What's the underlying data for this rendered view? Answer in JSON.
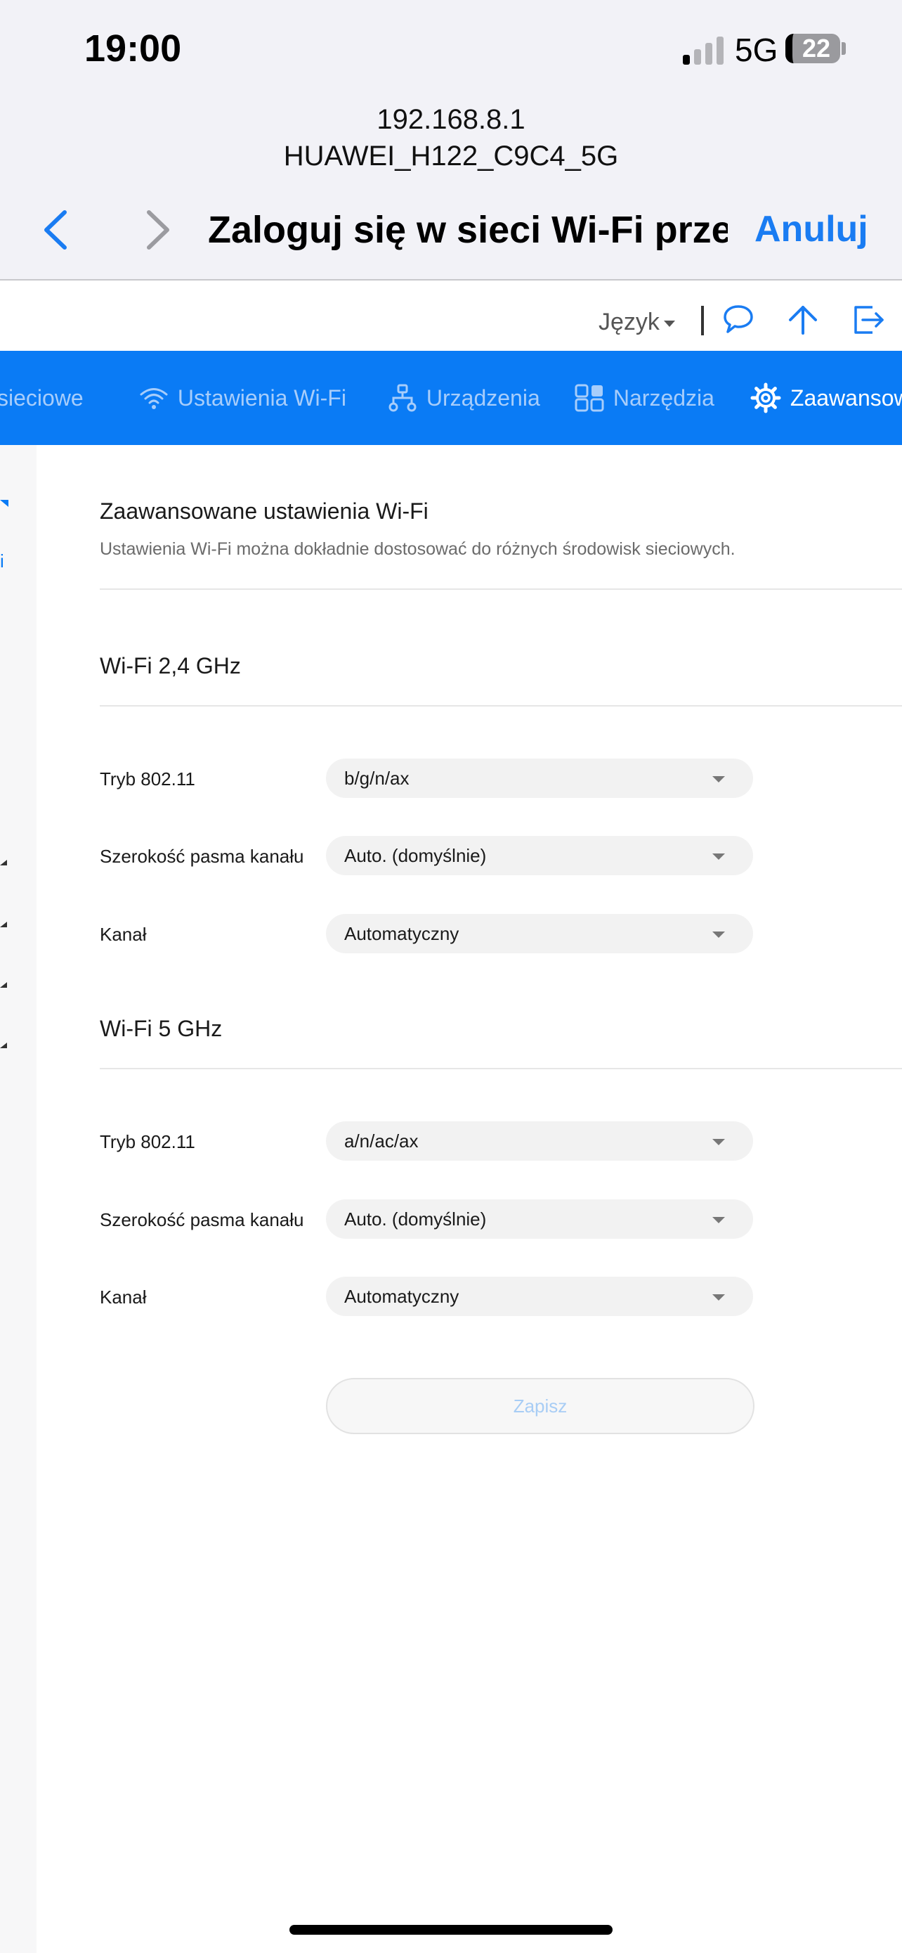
{
  "status_bar": {
    "time": "19:00",
    "network": "5G",
    "battery": "22"
  },
  "portal": {
    "url": "192.168.8.1",
    "ssid": "HUAWEI_H122_C9C4_5G",
    "title": "Zaloguj się w sieci Wi-Fi prze...",
    "cancel_label": "Anuluj"
  },
  "top_bar": {
    "language_label": "Język"
  },
  "nav": {
    "items": [
      {
        "label": "sieciowe",
        "icon": "none"
      },
      {
        "label": "Ustawienia Wi-Fi",
        "icon": "wifi-icon"
      },
      {
        "label": "Urządzenia",
        "icon": "devices-icon"
      },
      {
        "label": "Narzędzia",
        "icon": "tools-icon"
      },
      {
        "label": "Zaawansowane",
        "icon": "gear-icon",
        "active": true
      }
    ]
  },
  "sidebar": {
    "fragment_text": "i"
  },
  "page": {
    "title": "Zaawansowane ustawienia Wi-Fi",
    "description": "Ustawienia Wi-Fi można dokładnie dostosować do różnych środowisk sieciowych."
  },
  "wifi24": {
    "title": "Wi-Fi 2,4 GHz",
    "fields": [
      {
        "label": "Tryb 802.11",
        "value": "b/g/n/ax"
      },
      {
        "label": "Szerokość pasma kanału",
        "value": "Auto. (domyślnie)"
      },
      {
        "label": "Kanał",
        "value": "Automatyczny"
      }
    ]
  },
  "wifi5": {
    "title": "Wi-Fi 5 GHz",
    "fields": [
      {
        "label": "Tryb 802.11",
        "value": "a/n/ac/ax"
      },
      {
        "label": "Szerokość pasma kanału",
        "value": "Auto. (domyślnie)"
      },
      {
        "label": "Kanał",
        "value": "Automatyczny"
      }
    ]
  },
  "actions": {
    "save_label": "Zapisz"
  },
  "colors": {
    "accent": "#0a7bf5",
    "ios_blue": "#1a7cf2",
    "nav_inactive": "#a7cdfb"
  }
}
